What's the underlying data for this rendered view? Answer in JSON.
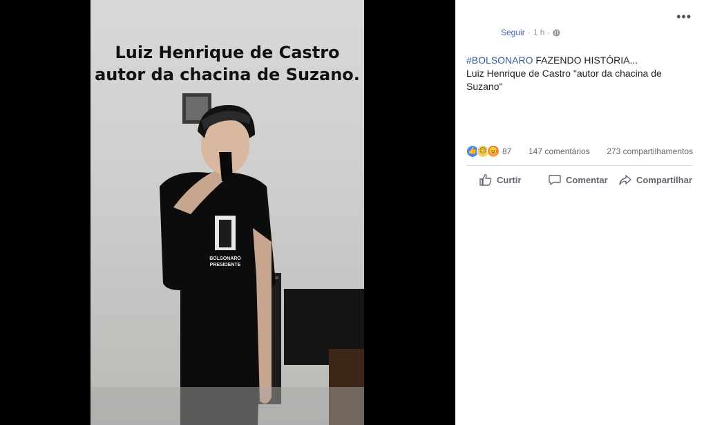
{
  "photo": {
    "caption_line1": "Luiz Henrique de Castro",
    "caption_line2": "autor da chacina de Suzano.",
    "shirt_text_line1": "BOLSONARO",
    "shirt_text_line2": "PRESIDENTE"
  },
  "header": {
    "more_label": "•••",
    "follow_label": "Seguir",
    "separator": "·",
    "time": "1 h",
    "privacy_icon": "globe-icon"
  },
  "post": {
    "hashtag": "#BOLSONARO",
    "text_line1_rest": " FAZENDO HISTÓRIA...",
    "text_line2": "Luiz Henrique de Castro \"autor da chacina de Suzano\""
  },
  "stats": {
    "reaction_icons": [
      "like-icon",
      "sad-icon",
      "angry-icon"
    ],
    "reaction_count": "87",
    "comments": "147 comentários",
    "shares": "273 compartilhamentos"
  },
  "actions": {
    "like_label": "Curtir",
    "comment_label": "Comentar",
    "share_label": "Compartilhar"
  },
  "colors": {
    "link_blue": "#4267b2",
    "hashtag_blue": "#385898",
    "text_dark": "#1d2129",
    "text_muted": "#606770"
  }
}
